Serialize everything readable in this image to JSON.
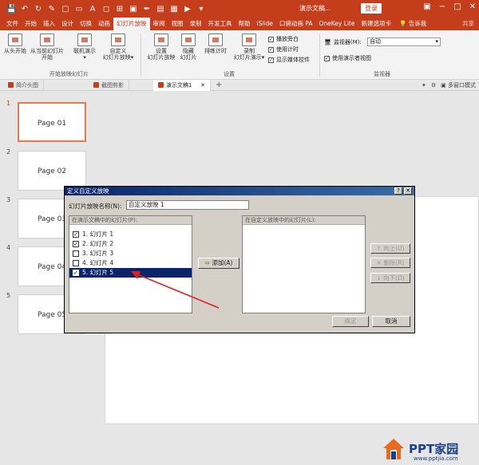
{
  "title_bar": {
    "title": "演示文稿...",
    "login_label": "登录",
    "window_controls": [
      "−",
      "□",
      "✕"
    ]
  },
  "menu_tabs": [
    "文件",
    "开始",
    "插入",
    "设计",
    "切换",
    "动画",
    "幻灯片放映",
    "审阅",
    "视图",
    "录制",
    "开发工具",
    "帮助",
    "iSlide",
    "口袋动画 PA",
    "OneKey Lite",
    "新建选项卡"
  ],
  "active_tab": "幻灯片放映",
  "tell_me": "告诉我",
  "share": "共享",
  "ribbon": {
    "buttons": [
      {
        "label1": "从头开始",
        "label2": ""
      },
      {
        "label1": "从当前幻灯片",
        "label2": "开始"
      },
      {
        "label1": "联机演示",
        "label2": "▾"
      },
      {
        "label1": "自定义",
        "label2": "幻灯片放映▾"
      },
      {
        "label1": "设置",
        "label2": "幻灯片放映"
      },
      {
        "label1": "隐藏",
        "label2": "幻灯片"
      },
      {
        "label1": "排练计时",
        "label2": ""
      },
      {
        "label1": "录制",
        "label2": "幻灯片演示▾"
      }
    ],
    "checks": [
      "播放旁白",
      "使用计时",
      "显示媒体控件"
    ],
    "group_start": "开始放映幻灯片",
    "group_setup": "设置",
    "group_monitor": "监视器",
    "monitor_label": "监视器(M):",
    "monitor_value": "自动",
    "presenter_view": "使用演示者视图"
  },
  "doc_tabs": [
    "简介头图",
    "截图剪影",
    "演示文稿1"
  ],
  "active_doc_tab": "演示文稿1",
  "right_tools": [
    "+",
    "多窗口模式"
  ],
  "slides": [
    {
      "num": "1",
      "label": "Page 01"
    },
    {
      "num": "2",
      "label": "Page 02"
    },
    {
      "num": "3",
      "label": "Page 03"
    },
    {
      "num": "4",
      "label": "Page 04"
    },
    {
      "num": "5",
      "label": "Page 05"
    }
  ],
  "dialog": {
    "title": "定义自定义放映",
    "help": "?",
    "close": "✕",
    "name_label": "幻灯片放映名称(N):",
    "name_value": "自定义放映 1",
    "left_header": "在演示文稿中的幻灯片(P):",
    "right_header": "在自定义放映中的幻灯片(L):",
    "items": [
      {
        "label": "1. 幻灯片 1",
        "checked": "✓"
      },
      {
        "label": "2. 幻灯片 2",
        "checked": "✓"
      },
      {
        "label": "3. 幻灯片 3",
        "checked": ""
      },
      {
        "label": "4. 幻灯片 4",
        "checked": ""
      },
      {
        "label": "5. 幻灯片 5",
        "checked": "✓"
      }
    ],
    "add_label": "添加(A)",
    "up_label": "↑ 向上(U)",
    "delete_label": "✕ 删除(R)",
    "down_label": "↓ 向下(D)",
    "ok_label": "确定",
    "cancel_label": "取消"
  },
  "logo": {
    "name": "PPT家园",
    "url": "www.pptjia.com"
  }
}
